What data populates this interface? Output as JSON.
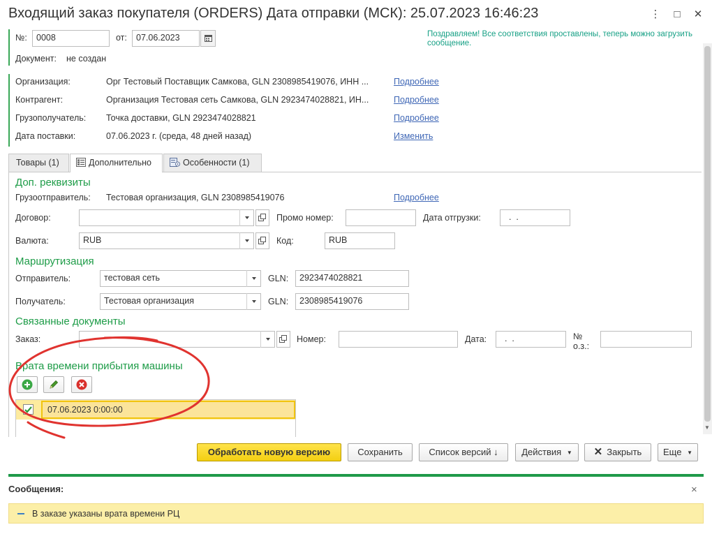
{
  "window": {
    "title": "Входящий заказ покупателя (ORDERS) Дата отправки (МСК): 25.07.2023 16:46:23",
    "more_glyph": "⋮",
    "maximize_glyph": "□",
    "close_glyph": "✕"
  },
  "header": {
    "number_label": "№:",
    "number_value": "0008",
    "from_label": "от:",
    "date_value": "07.06.2023",
    "document_label": "Документ:",
    "document_value": "не создан",
    "notice": "Поздравляем! Все соответствия проставлены, теперь можно загрузить сообщение."
  },
  "info_rows": [
    {
      "label": "Организация:",
      "value": "Орг Тестовый Поставщик Самкова, GLN 2308985419076, ИНН ...",
      "link": "Подробнее"
    },
    {
      "label": "Контрагент:",
      "value": "Организация Тестовая сеть Самкова, GLN 2923474028821, ИН...",
      "link": "Подробнее"
    },
    {
      "label": "Грузополучатель:",
      "value": "Точка доставки, GLN 2923474028821",
      "link": "Подробнее"
    },
    {
      "label": "Дата поставки:",
      "value": "07.06.2023 г. (среда, 48 дней назад)",
      "link": "Изменить"
    }
  ],
  "tabs": [
    {
      "label": "Товары (1)"
    },
    {
      "label": "Дополнительно"
    },
    {
      "label": "Особенности (1)"
    }
  ],
  "dop": {
    "title": "Доп. реквизиты",
    "shipper_label": "Грузоотправитель:",
    "shipper_value": "Тестовая организация, GLN 2308985419076",
    "shipper_link": "Подробнее",
    "contract_label": "Договор:",
    "contract_value": "",
    "promo_label": "Промо номер:",
    "promo_value": "",
    "ship_date_label": "Дата отгрузки:",
    "ship_date_value": "  .  .",
    "currency_label": "Валюта:",
    "currency_value": "RUB",
    "code_label": "Код:",
    "code_value": "RUB"
  },
  "routing": {
    "title": "Маршрутизация",
    "sender_label": "Отправитель:",
    "sender_value": "тестовая сеть",
    "sender_gln_label": "GLN:",
    "sender_gln_value": "2923474028821",
    "receiver_label": "Получатель:",
    "receiver_value": "Тестовая организация",
    "receiver_gln_label": "GLN:",
    "receiver_gln_value": "2308985419076"
  },
  "related": {
    "title": "Связанные документы",
    "order_label": "Заказ:",
    "order_value": "",
    "number_label": "Номер:",
    "number_value": "",
    "date_label": "Дата:",
    "date_value": "  .  .",
    "oz_label": "№ о.з.:",
    "oz_value": ""
  },
  "gates": {
    "title": "Врата времени прибытия машины",
    "rows": [
      {
        "value": "07.06.2023 0:00:00",
        "checked": true
      }
    ]
  },
  "buttons": {
    "process": "Обработать новую версию",
    "save": "Сохранить",
    "versions": "Список версий ↓",
    "actions": "Действия",
    "close": "Закрыть",
    "more": "Еще"
  },
  "messages": {
    "title": "Сообщения:",
    "close_glyph": "×",
    "items": [
      {
        "text": "В заказе указаны врата времени РЦ"
      }
    ]
  },
  "colors": {
    "accent_green": "#1e9c48",
    "link_blue": "#3f67b6",
    "annotation_red": "#e0332f",
    "highlight_yellow": "#fdeb9e"
  }
}
